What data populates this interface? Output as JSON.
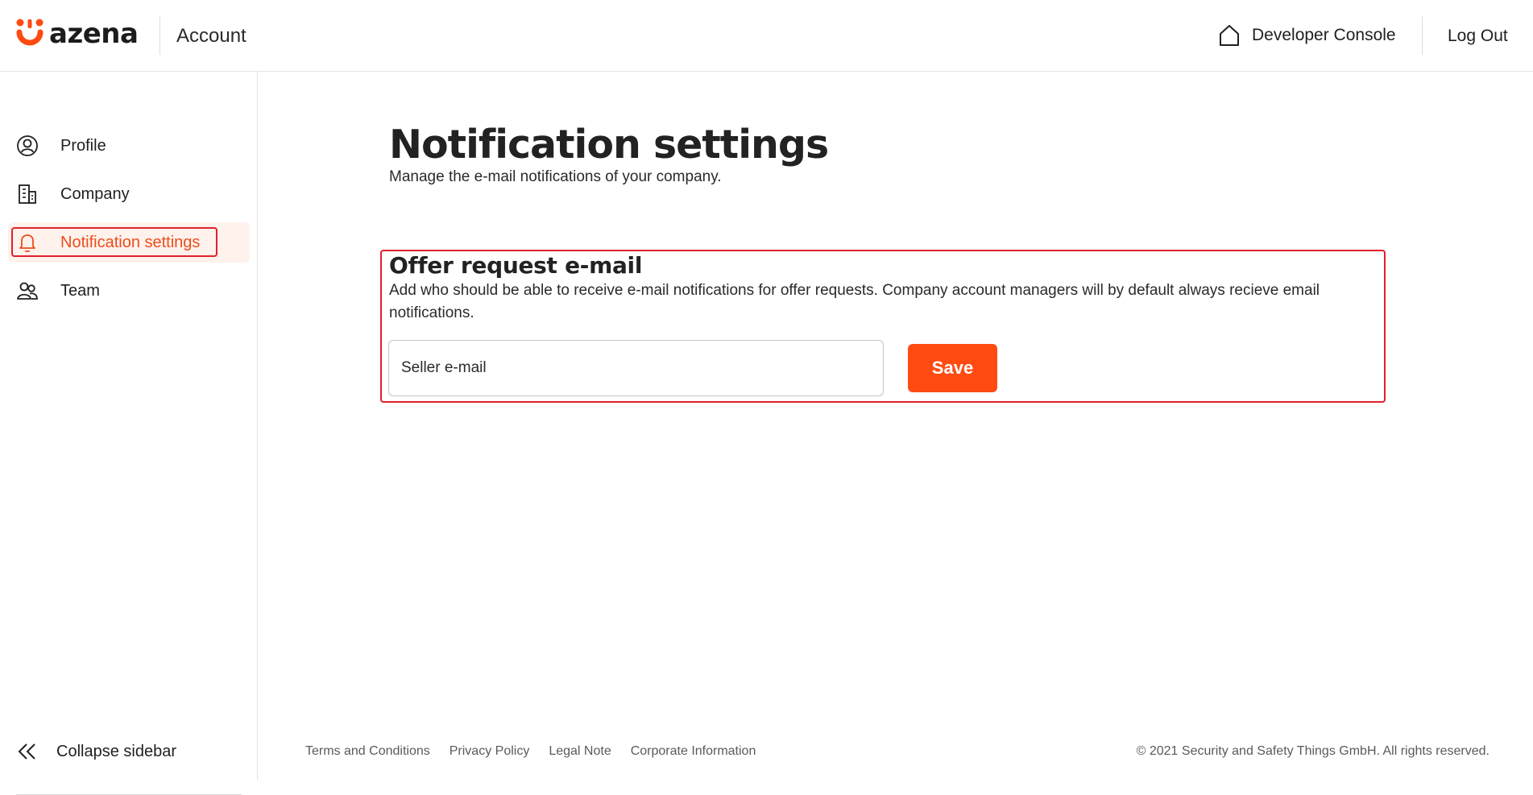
{
  "header": {
    "brand": "azena",
    "app_title": "Account",
    "developer_console_label": "Developer Console",
    "logout_label": "Log Out"
  },
  "sidebar": {
    "items": [
      {
        "label": "Profile",
        "icon": "user-circle-icon",
        "active": false
      },
      {
        "label": "Company",
        "icon": "building-icon",
        "active": false
      },
      {
        "label": "Notification settings",
        "icon": "bell-icon",
        "active": true
      },
      {
        "label": "Team",
        "icon": "team-icon",
        "active": false
      }
    ],
    "collapse_label": "Collapse sidebar"
  },
  "main": {
    "title": "Notification settings",
    "subtitle": "Manage the e-mail notifications of your company.",
    "section": {
      "title": "Offer request e-mail",
      "description": "Add who should be able to receive e-mail notifications for offer requests. Company account managers will by default always recieve email notifications.",
      "input_placeholder": "Seller e-mail",
      "input_value": "",
      "save_label": "Save"
    }
  },
  "footer": {
    "links": [
      "Terms and Conditions",
      "Privacy Policy",
      "Legal Note",
      "Corporate Information"
    ],
    "copyright": "© 2021 Security and Safety Things GmbH. All rights reserved."
  },
  "colors": {
    "accent": "#ff4b12",
    "active_text": "#e94f1c",
    "active_bg": "#fff1ec",
    "highlight_border": "#e0202a"
  }
}
